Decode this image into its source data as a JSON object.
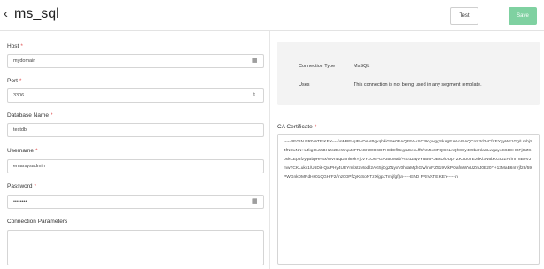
{
  "header": {
    "back_glyph": "‹",
    "title": "ms_sql",
    "test_label": "Test",
    "save_label": "Save"
  },
  "form": {
    "host": {
      "label": "Host",
      "required": "*",
      "value": "mydomain"
    },
    "port": {
      "label": "Port",
      "required": "*",
      "value": "3306"
    },
    "database": {
      "label": "Database Name",
      "required": "*",
      "value": "testdb"
    },
    "username": {
      "label": "Username",
      "required": "*",
      "value": "emarsysadmin"
    },
    "password": {
      "label": "Password",
      "required": "*",
      "value": "••••••••"
    },
    "connection_parameters": {
      "label": "Connection Parameters",
      "value": ""
    }
  },
  "info": {
    "type_label": "Connection Type",
    "type_value": "MsSQL",
    "uses_label": "Uses",
    "uses_value": "This connection is not being used in any segment template."
  },
  "certificate": {
    "label": "CA Certificate",
    "required": "*",
    "value": "-----BEGIN PRIVATE KEY-----\\nMIIEvgIBADANBgkqhkiG9w0BAQEFAASCBKgwggSkAgEAAoIBAQCnS3d2vCfKFYgyWz1Gg/LrnbjS4fNDuNN+LJkgOuWBHZc2BeW1pJoFRAGK008GDFH8bEfl9egs/CecLff5\\nMLv8RQCKLnQhtWy409bqKlaSLwgayoS61EHGFj0lZS0xkCEp8fzyqBbpHHkx/MVnLqDanl8skYjLVYZO6PGA35uMab/+tGuJayvYBB6PJBxD/DUpYZKuU0TEzdKl3N6bKGIUZFz\\nIT8B9VJmwTCKLukx1/U6DiHQx/PHy4UBYmkstzModjl2AG5jOgZNyxV0hoaMphGW\\nxFZ519VtkPOafmWVUZmJ0B20Y+13MaB6nIYjf28/59PWGnkDMRdHs01QGHrF2/\\nz0DPfZyKrSoNTzX/gpJTm.jfgf)\\n-----END PRIVATE KEY-----\\n"
  }
}
